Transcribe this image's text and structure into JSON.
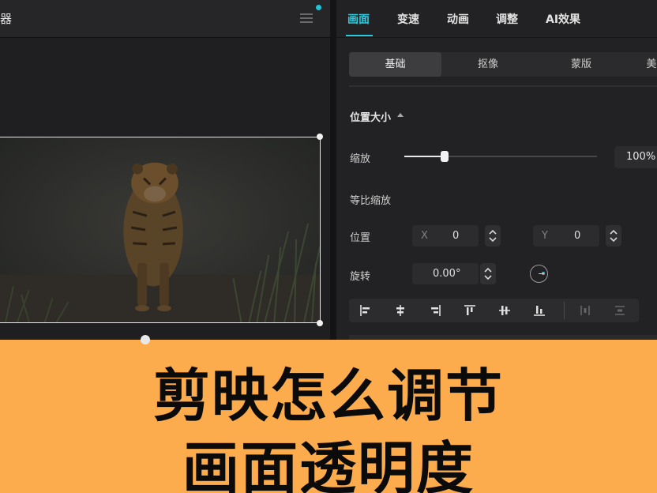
{
  "player": {
    "title": "器"
  },
  "inspector": {
    "tabs": [
      {
        "label": "画面",
        "active": true
      },
      {
        "label": "变速",
        "active": false
      },
      {
        "label": "动画",
        "active": false
      },
      {
        "label": "调整",
        "active": false
      },
      {
        "label": "AI效果",
        "active": false
      }
    ],
    "subtabs": [
      {
        "label": "基础",
        "active": true
      },
      {
        "label": "抠像",
        "active": false
      },
      {
        "label": "蒙版",
        "active": false
      },
      {
        "label": "美",
        "active": false
      }
    ],
    "section_title": "位置大小",
    "scale": {
      "label": "缩放",
      "value": "100%",
      "slider_fraction": 0.21
    },
    "uniform_scale_label": "等比缩放",
    "position": {
      "label": "位置",
      "x_axis": "X",
      "x_value": "0",
      "y_axis": "Y",
      "y_value": "0"
    },
    "rotation": {
      "label": "旋转",
      "value": "0.00°"
    },
    "align_buttons": [
      "align-left-icon",
      "align-center-h-icon",
      "align-right-icon",
      "align-top-icon",
      "align-center-v-icon",
      "align-bottom-icon",
      "distribute-h-icon",
      "distribute-v-icon"
    ]
  },
  "banner": {
    "line1": "剪映怎么调节",
    "line2": "画面透明度",
    "background": "#fdac4d"
  },
  "colors": {
    "accent": "#2ec9dc",
    "panel": "#222224"
  }
}
